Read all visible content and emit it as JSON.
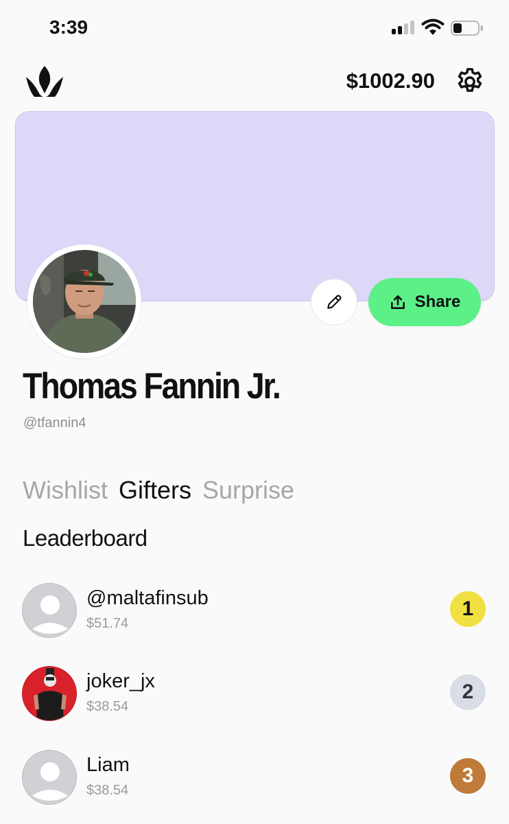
{
  "status_bar": {
    "time": "3:39"
  },
  "header": {
    "balance": "$1002.90",
    "logo_icon": "crown-icon",
    "settings_icon": "gear-icon"
  },
  "profile": {
    "name": "Thomas Fannin Jr.",
    "handle": "@tfannin4",
    "banner_color": "#ddd8f7",
    "share_label": "Share",
    "share_color": "#5bf088",
    "edit_icon": "pencil-icon",
    "share_icon": "share-upload-icon"
  },
  "tabs": [
    {
      "label": "Wishlist",
      "active": false
    },
    {
      "label": "Gifters",
      "active": true
    },
    {
      "label": "Surprise",
      "active": false
    }
  ],
  "leaderboard": {
    "title": "Leaderboard",
    "rows": [
      {
        "name": "@maltafinsub",
        "amount": "$51.74",
        "rank": "1",
        "rank_color": "#f0e042"
      },
      {
        "name": "joker_jx",
        "amount": "$38.54",
        "rank": "2",
        "rank_color": "#d8dde6"
      },
      {
        "name": "Liam",
        "amount": "$38.54",
        "rank": "3",
        "rank_color": "#c07a3a"
      }
    ]
  }
}
